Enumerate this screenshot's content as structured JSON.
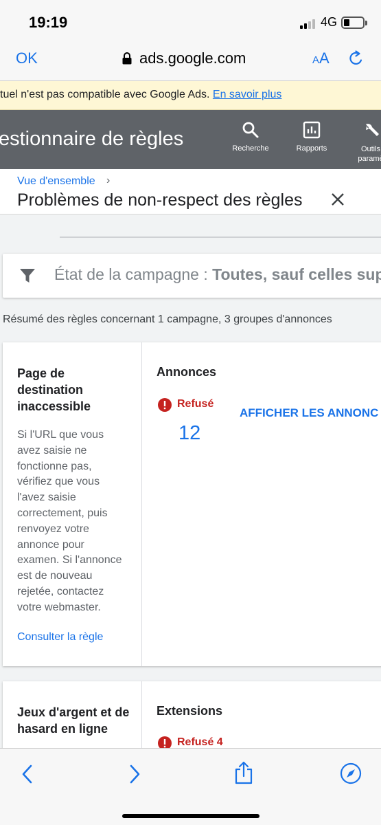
{
  "status_bar": {
    "time": "19:19",
    "network": "4G"
  },
  "browser": {
    "done_label": "OK",
    "url": "ads.google.com",
    "text_size_small": "A",
    "text_size_large": "A"
  },
  "banner": {
    "text": "tuel n'est pas compatible avec Google Ads. ",
    "link": "En savoir plus"
  },
  "appbar": {
    "title": "estionnaire de règles",
    "tools": [
      {
        "label": "Recherche",
        "icon": "search-icon"
      },
      {
        "label": "Rapports",
        "icon": "reports-icon"
      },
      {
        "label": "Outils paramè",
        "icon": "wrench-icon"
      }
    ]
  },
  "header": {
    "breadcrumb": "Vue d'ensemble",
    "breadcrumb_separator": "›",
    "title": "Problèmes de non-respect des règles"
  },
  "filter": {
    "label": "État de la campagne : ",
    "value": "Toutes, sauf celles sup"
  },
  "summary": "Résumé des règles concernant 1 campagne, 3 groupes d'annonces",
  "cards": [
    {
      "rule_title": "Page de destination inaccessible",
      "description": "Si l'URL que vous avez saisie ne fonctionne pas, vérifiez que vous l'avez saisie correctement, puis renvoyez votre annonce pour examen. Si l'annonce est de nouveau rejetée, contactez votre webmaster.",
      "link": "Consulter la règle",
      "column_header": "Annonces",
      "status": "Refusé",
      "count": "12",
      "action": "AFFICHER LES ANNONC"
    },
    {
      "rule_title": "Jeux d'argent et de hasard en ligne",
      "column_header": "Extensions",
      "status": "Refusé 4"
    }
  ],
  "colors": {
    "accent": "#1a73e8",
    "error": "#c5221f",
    "appbar": "#5f6368",
    "banner": "#fef7d5"
  }
}
